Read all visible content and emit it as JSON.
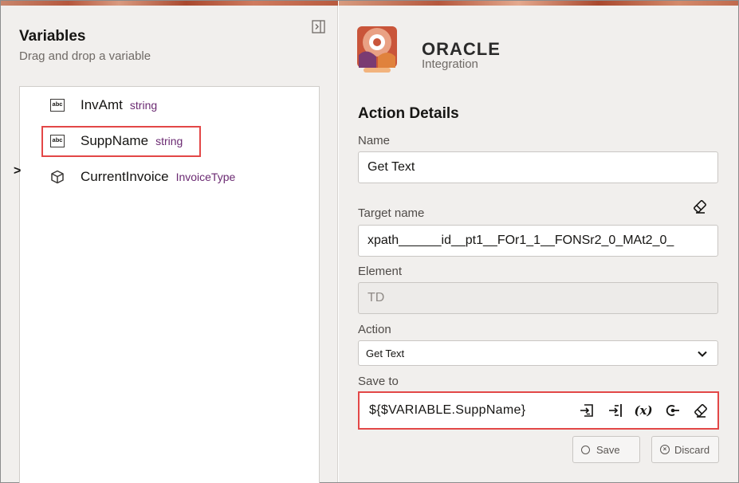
{
  "variables_panel": {
    "title": "Variables",
    "subtitle": "Drag and drop a variable",
    "collapse_icon": "panel-collapse-icon",
    "items": [
      {
        "name": "InvAmt",
        "type": "string",
        "icon": "abc-string-icon"
      },
      {
        "name": "SuppName",
        "type": "string",
        "icon": "abc-string-icon"
      },
      {
        "name": "CurrentInvoice",
        "type": "InvoiceType",
        "icon": "cube-object-icon",
        "expander": ">"
      }
    ]
  },
  "brand": {
    "name": "ORACLE",
    "product": "Integration"
  },
  "action_details": {
    "title": "Action Details",
    "name_label": "Name",
    "name_value": "Get Text",
    "target_label": "Target name",
    "target_value": "xpath______id__pt1__FOr1_1__FONSr2_0_MAt2_0_",
    "element_label": "Element",
    "element_value": "TD",
    "action_label": "Action",
    "action_value": "Get Text",
    "save_to_label": "Save to",
    "save_to_value": "${$VARIABLE.SuppName}",
    "save_to_fx": "(x)",
    "save_button": "Save",
    "discard_button": "Discard"
  },
  "colors": {
    "highlight": "#e34747",
    "type_text": "#6b2a72",
    "panel_bg": "#f1efed"
  }
}
